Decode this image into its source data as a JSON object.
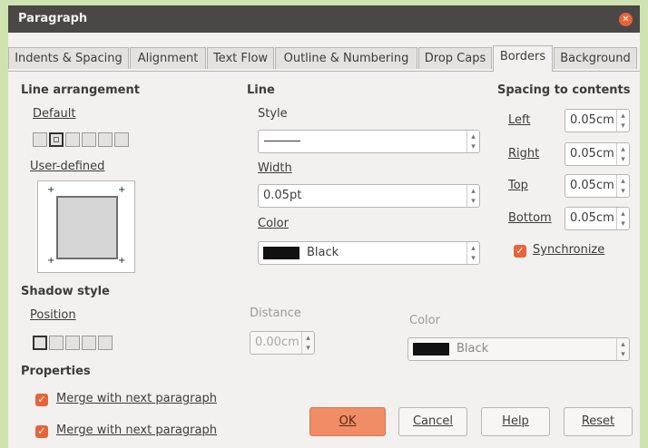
{
  "window": {
    "title": "Paragraph"
  },
  "tabs": [
    {
      "label": "Indents & Spacing"
    },
    {
      "label": "Alignment"
    },
    {
      "label": "Text Flow"
    },
    {
      "label": "Outline & Numbering"
    },
    {
      "label": "Drop Caps"
    },
    {
      "label": "Borders"
    },
    {
      "label": "Background"
    }
  ],
  "line_arrangement": {
    "heading": "Line arrangement",
    "default_label": "Default",
    "user_defined_label": "User-defined"
  },
  "line": {
    "heading": "Line",
    "style_label": "Style",
    "width_label": "Width",
    "width_value": "0.05pt",
    "color_label": "Color",
    "color_value": "Black"
  },
  "spacing": {
    "heading": "Spacing to contents",
    "left_label": "Left",
    "left_value": "0.05cm",
    "right_label": "Right",
    "right_value": "0.05cm",
    "top_label": "Top",
    "top_value": "0.05cm",
    "bottom_label": "Bottom",
    "bottom_value": "0.05cm",
    "synchronize_label": "Synchronize"
  },
  "shadow": {
    "heading": "Shadow style",
    "position_label": "Position",
    "distance_label": "Distance",
    "distance_value": "0.00cm",
    "color_label": "Color",
    "color_value": "Black"
  },
  "properties": {
    "heading": "Properties",
    "merge1_label": "Merge with next paragraph",
    "merge2_label": "Merge with next paragraph"
  },
  "buttons": {
    "ok": "OK",
    "cancel": "Cancel",
    "help": "Help",
    "reset": "Reset"
  },
  "colors": {
    "accent": "#e8633a",
    "titlebar": "#4a4846",
    "background": "#f2f1f0"
  }
}
